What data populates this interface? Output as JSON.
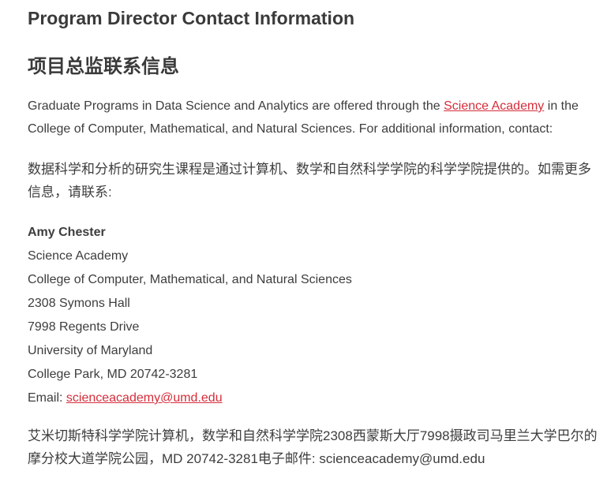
{
  "heading_en": "Program Director Contact Information",
  "heading_zh": "项目总监联系信息",
  "intro_en": {
    "before": "Graduate Programs in Data Science and Analytics are offered through the ",
    "link": "Science Academy",
    "after": " in the College of Computer, Mathematical, and Natural Sciences. For additional information, contact:"
  },
  "intro_zh": "数据科学和分析的研究生课程是通过计算机、数学和自然科学学院的科学学院提供的。如需更多信息，请联系:",
  "contact": {
    "name": "Amy Chester",
    "org": "Science Academy",
    "college": "College of Computer, Mathematical, and Natural Sciences",
    "room": "2308 Symons Hall",
    "street": "7998 Regents Drive",
    "university": "University of Maryland",
    "city": "College Park, MD 20742-3281",
    "email_label": "Email: ",
    "email": "scienceacademy@umd.edu"
  },
  "contact_zh": "艾米切斯特科学学院计算机，数学和自然科学学院2308西蒙斯大厅7998摄政司马里兰大学巴尔的摩分校大道学院公园，MD 20742-3281电子邮件: scienceacademy@umd.edu",
  "colors": {
    "link": "#d52d3a",
    "text": "#3d3d3d",
    "heading": "#3a3a3a"
  }
}
